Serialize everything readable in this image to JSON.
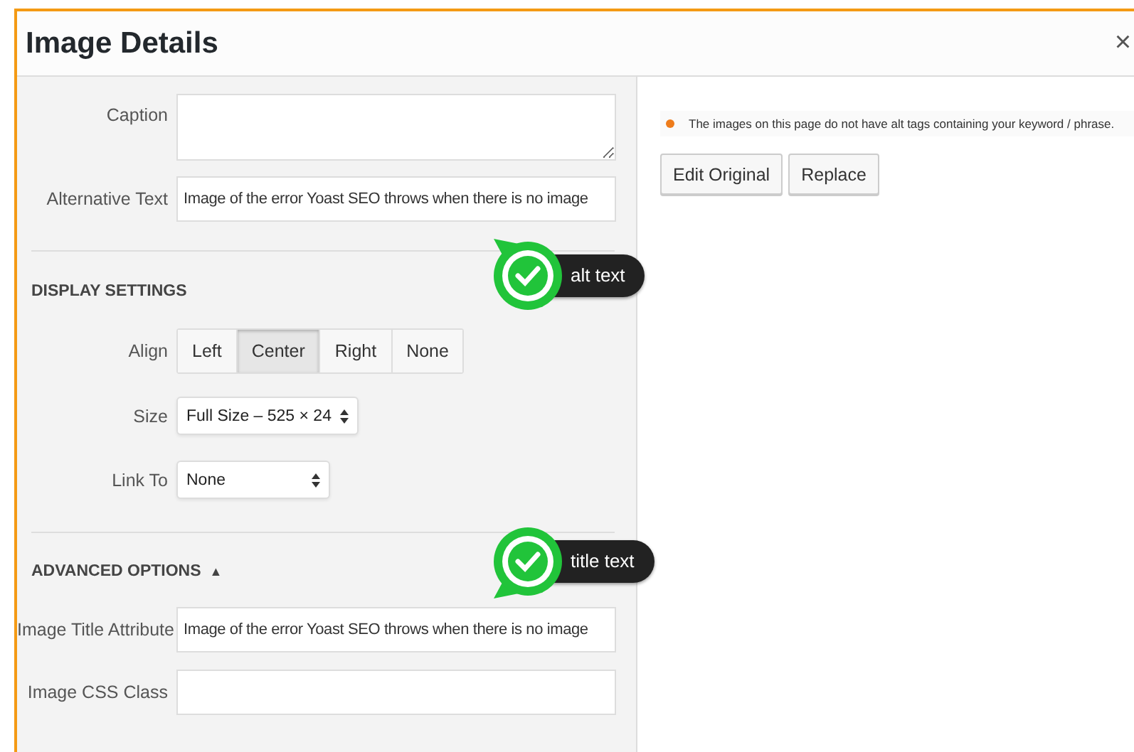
{
  "window": {
    "title": "Image Details",
    "close": "×"
  },
  "attachment": {
    "caption": {
      "label": "Caption"
    },
    "alt_text": {
      "label": "Alternative Text",
      "value": "Image of the error Yoast SEO throws when there is no image"
    }
  },
  "display_settings": {
    "heading": "DISPLAY SETTINGS",
    "align": {
      "label": "Align",
      "options": [
        {
          "label": "Left",
          "selected": false
        },
        {
          "label": "Center",
          "selected": true
        },
        {
          "label": "Right",
          "selected": false
        },
        {
          "label": "None",
          "selected": false
        }
      ]
    },
    "size": {
      "label": "Size",
      "value": "Full Size – 525 × 24"
    },
    "link_to": {
      "label": "Link To",
      "value": "None"
    }
  },
  "advanced_options": {
    "heading": "ADVANCED OPTIONS",
    "toggle": "▲",
    "expanded": true,
    "title_attribute": {
      "label": "Image Title Attribute",
      "value": "Image of the error Yoast SEO throws when there is no image"
    },
    "css_class": {
      "label": "Image CSS Class"
    }
  },
  "notice": {
    "text": "The images on this page do not have alt tags containing your keyword / phrase.",
    "color": "#ee7c1b"
  },
  "buttons": [
    "Edit Original",
    "Replace"
  ],
  "annotations": [
    {
      "label": "alt text",
      "kind": "up"
    },
    {
      "label": "title text",
      "kind": "down"
    }
  ]
}
